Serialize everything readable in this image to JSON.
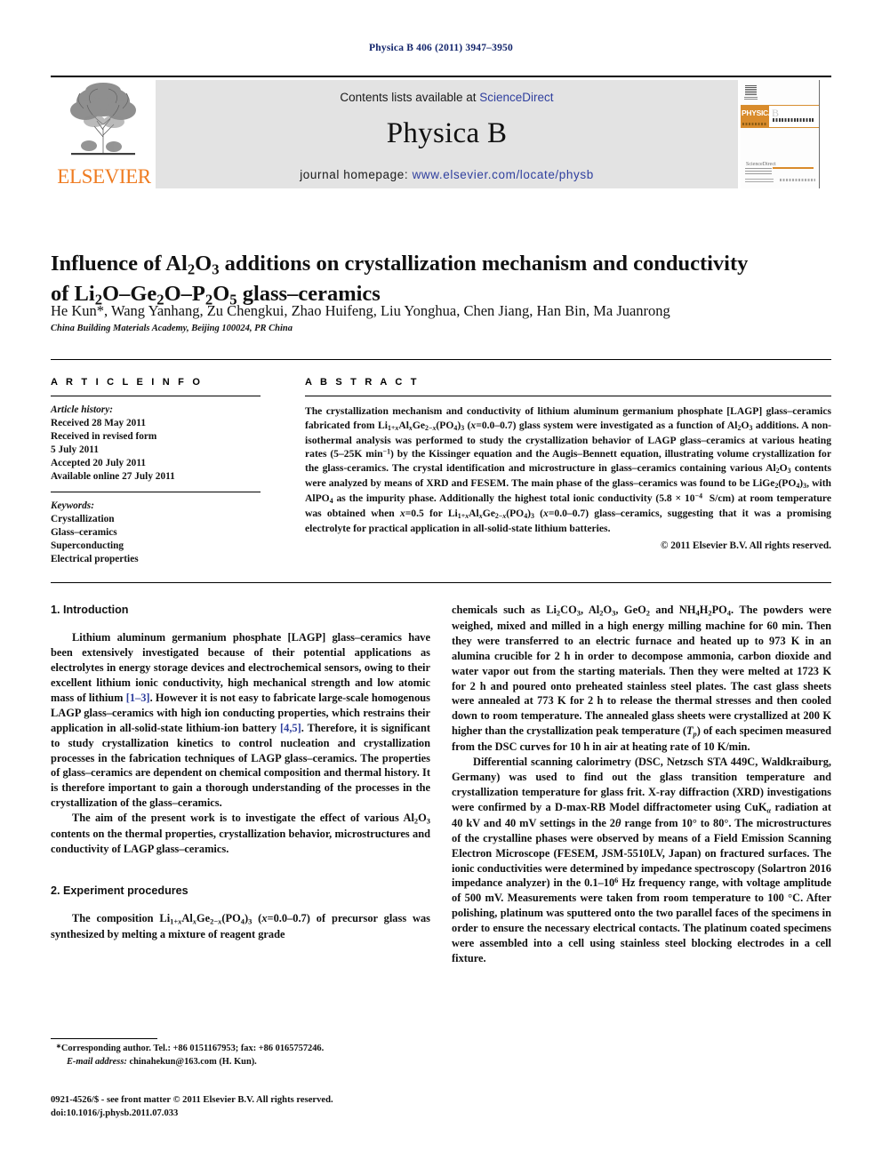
{
  "running_head": "Physica B 406 (2011) 3947–3950",
  "masthead": {
    "contents_prefix": "Contents lists available at",
    "contents_link": "ScienceDirect",
    "journal_name": "Physica B",
    "homepage_prefix": "journal homepage:",
    "homepage_link": "www.elsevier.com/locate/physb",
    "publisher_wordmark": "ELSEVIER",
    "cover": {
      "badge": "PHYSICA",
      "volume_letter": "B",
      "sciencedirect_mark": "ScienceDirect"
    }
  },
  "article": {
    "title_line1_pre": "Influence of Al",
    "title": "Influence of Al2O3 additions on crystallization mechanism and conductivity of Li2O–Ge2O–P2O5 glass–ceramics",
    "authors": "He Kun*, Wang Yanhang, Zu Chengkui, Zhao Huifeng, Liu Yonghua, Chen Jiang, Han Bin, Ma Juanrong",
    "affiliation": "China Building Materials Academy, Beijing 100024, PR China"
  },
  "info": {
    "heading": "A R T I C L E   I N F O",
    "history_label": "Article history:",
    "history": [
      "Received 28 May 2011",
      "Received in revised form",
      "5 July 2011",
      "Accepted 20 July 2011",
      "Available online 27 July 2011"
    ],
    "keywords_label": "Keywords:",
    "keywords": [
      "Crystallization",
      "Glass–ceramics",
      "Superconducting",
      "Electrical properties"
    ]
  },
  "abstract": {
    "heading": "A B S T R A C T",
    "copyright": "© 2011 Elsevier B.V. All rights reserved."
  },
  "sections": {
    "introduction_heading": "1.  Introduction",
    "experiment_heading": "2.  Experiment procedures"
  },
  "footnote": {
    "corresponding": "Corresponding author. Tel.: +86 0151167953; fax: +86 0165757246.",
    "email_label": "E-mail address:",
    "email": "chinahekun@163.com (H. Kun)."
  },
  "imprint": {
    "line1": "0921-4526/$ - see front matter © 2011 Elsevier B.V. All rights reserved.",
    "line2": "doi:10.1016/j.physb.2011.07.033"
  },
  "colors": {
    "link": "#2f3f9e",
    "elsevier_orange": "#ef7c22",
    "running_head": "#12246b",
    "band_gray": "#e3e3e3"
  }
}
